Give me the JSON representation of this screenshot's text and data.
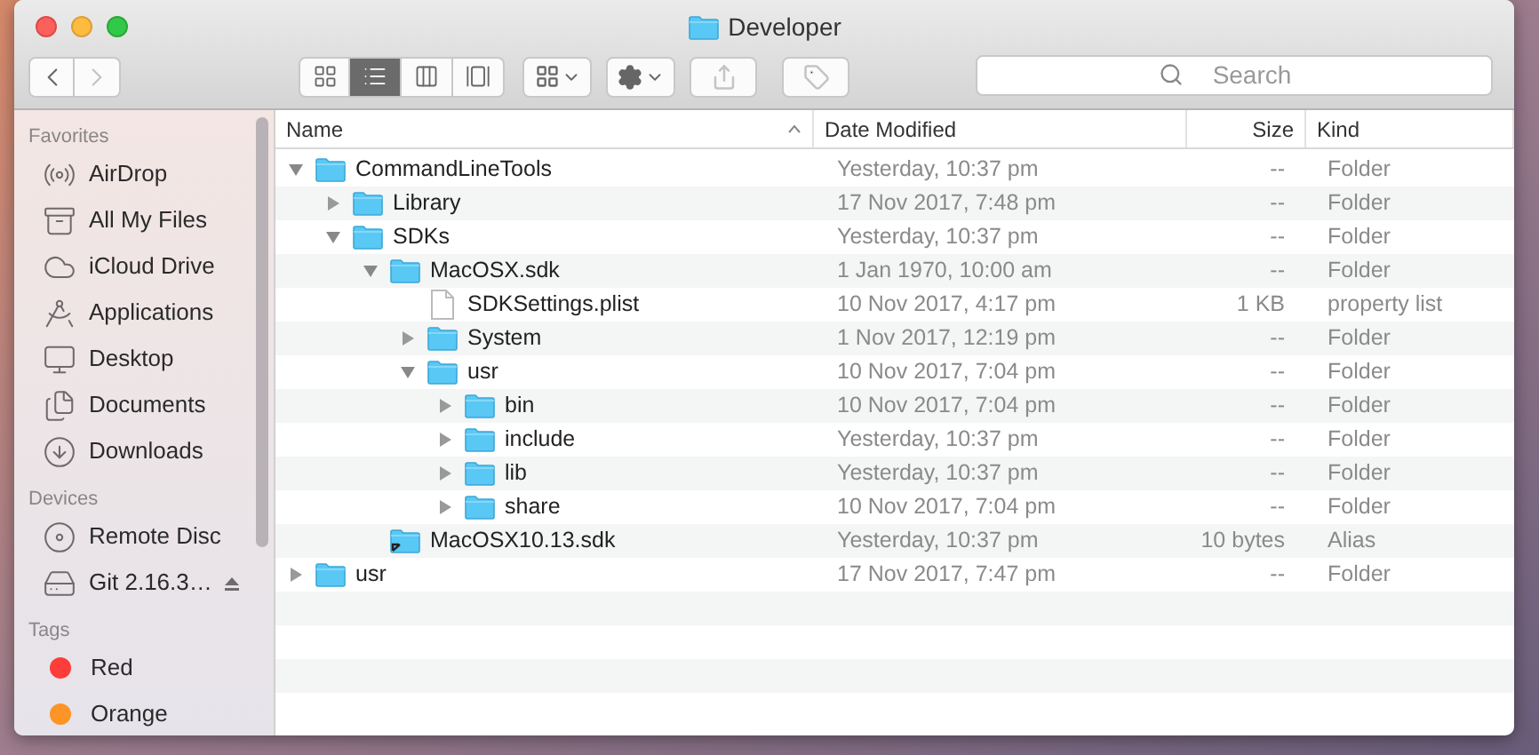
{
  "window": {
    "title": "Developer"
  },
  "toolbar": {
    "nav": [
      {
        "kind": "back",
        "disabled": false
      },
      {
        "kind": "forward",
        "disabled": true
      }
    ],
    "views": [
      {
        "kind": "icons",
        "selected": false
      },
      {
        "kind": "list",
        "selected": true
      },
      {
        "kind": "columns",
        "selected": false
      },
      {
        "kind": "coverflow",
        "selected": false
      }
    ],
    "actions": [
      {
        "kind": "arrange",
        "disabled": false
      },
      {
        "kind": "action",
        "disabled": false
      },
      {
        "kind": "share",
        "disabled": true
      },
      {
        "kind": "tags",
        "disabled": true
      }
    ],
    "search": {
      "placeholder": "Search"
    }
  },
  "sidebar": {
    "sections": [
      {
        "title": "Favorites",
        "items": [
          {
            "kind": "airdrop",
            "label": "AirDrop"
          },
          {
            "kind": "files",
            "label": "All My Files"
          },
          {
            "kind": "cloud",
            "label": "iCloud Drive"
          },
          {
            "kind": "apps",
            "label": "Applications"
          },
          {
            "kind": "desktop",
            "label": "Desktop"
          },
          {
            "kind": "documents",
            "label": "Documents"
          },
          {
            "kind": "downloads",
            "label": "Downloads"
          }
        ]
      },
      {
        "title": "Devices",
        "items": [
          {
            "kind": "disc",
            "label": "Remote Disc"
          },
          {
            "kind": "drive",
            "label": "Git 2.16.3…",
            "ejectable": true
          }
        ]
      },
      {
        "title": "Tags",
        "items": [
          {
            "kind": "tag",
            "label": "Red",
            "color": "#fc3d39"
          },
          {
            "kind": "tag",
            "label": "Orange",
            "color": "#fd9426"
          }
        ]
      }
    ]
  },
  "table": {
    "columns": [
      {
        "label": "Name",
        "sorted": true
      },
      {
        "label": "Date Modified",
        "sorted": false
      },
      {
        "label": "Size",
        "sorted": false
      },
      {
        "label": "Kind",
        "sorted": false
      }
    ],
    "rows": [
      {
        "kind": "folder",
        "name": "CommandLineTools",
        "date": "Yesterday, 10:37 pm",
        "size": "--",
        "type": "Folder",
        "expanded": true,
        "children": [
          {
            "kind": "folder",
            "name": "Library",
            "date": "17 Nov 2017, 7:48 pm",
            "size": "--",
            "type": "Folder",
            "expanded": false
          },
          {
            "kind": "folder",
            "name": "SDKs",
            "date": "Yesterday, 10:37 pm",
            "size": "--",
            "type": "Folder",
            "expanded": true,
            "children": [
              {
                "kind": "folder",
                "name": "MacOSX.sdk",
                "date": "1 Jan 1970, 10:00 am",
                "size": "--",
                "type": "Folder",
                "expanded": true,
                "children": [
                  {
                    "kind": "file",
                    "name": "SDKSettings.plist",
                    "date": "10 Nov 2017, 4:17 pm",
                    "size": "1 KB",
                    "type": "property list"
                  },
                  {
                    "kind": "folder",
                    "name": "System",
                    "date": "1 Nov 2017, 12:19 pm",
                    "size": "--",
                    "type": "Folder",
                    "expanded": false
                  },
                  {
                    "kind": "folder",
                    "name": "usr",
                    "date": "10 Nov 2017, 7:04 pm",
                    "size": "--",
                    "type": "Folder",
                    "expanded": true,
                    "children": [
                      {
                        "kind": "folder",
                        "name": "bin",
                        "date": "10 Nov 2017, 7:04 pm",
                        "size": "--",
                        "type": "Folder",
                        "expanded": false
                      },
                      {
                        "kind": "folder",
                        "name": "include",
                        "date": "Yesterday, 10:37 pm",
                        "size": "--",
                        "type": "Folder",
                        "expanded": false
                      },
                      {
                        "kind": "folder",
                        "name": "lib",
                        "date": "Yesterday, 10:37 pm",
                        "size": "--",
                        "type": "Folder",
                        "expanded": false
                      },
                      {
                        "kind": "folder",
                        "name": "share",
                        "date": "10 Nov 2017, 7:04 pm",
                        "size": "--",
                        "type": "Folder",
                        "expanded": false
                      }
                    ]
                  }
                ]
              },
              {
                "kind": "alias",
                "name": "MacOSX10.13.sdk",
                "date": "Yesterday, 10:37 pm",
                "size": "10 bytes",
                "type": "Alias"
              }
            ]
          }
        ]
      },
      {
        "kind": "folder",
        "name": "usr",
        "date": "17 Nov 2017, 7:47 pm",
        "size": "--",
        "type": "Folder",
        "expanded": false
      }
    ]
  }
}
